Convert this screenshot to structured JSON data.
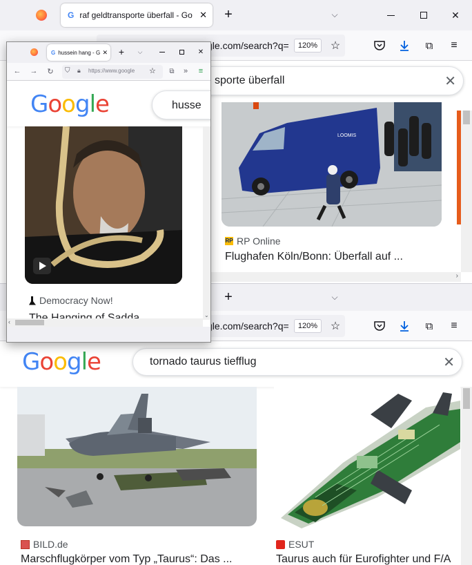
{
  "win_a": {
    "tab_title": "raf geldtransporte überfall - Go",
    "url_visible": "gle.com/search?q=",
    "zoom": "120%",
    "search_query_visible": "sporte überfall",
    "result": {
      "source": "RP Online",
      "title": "Flughafen Köln/Bonn: Überfall auf ..."
    },
    "van_text": "LOOMIS"
  },
  "win_b": {
    "url_visible": "gle.com/search?q=",
    "zoom": "120%",
    "search_query": "tornado taurus tiefflug",
    "results": [
      {
        "source": "BILD.de",
        "title": "Marschflugkörper vom Typ „Taurus“: Das ..."
      },
      {
        "source": "ESUT",
        "title": "Taurus auch für Eurofighter und F/A"
      }
    ]
  },
  "win_c": {
    "tab_title": "hussein hang - G",
    "url_visible": "https://www.google",
    "search_query_visible": "husse",
    "result": {
      "source": "Democracy Now!",
      "title": "The Hanging of Sadda"
    }
  },
  "google_logo": "Google",
  "colors": {
    "g_blue": "#4285f4",
    "g_red": "#ea4335",
    "g_yellow": "#fbbc05",
    "g_green": "#34a853",
    "firefox": "#ff7139",
    "accent": "#0060df"
  },
  "icons": [
    "firefox-icon",
    "google-favicon",
    "close-icon",
    "plus-icon",
    "chevron-down-icon",
    "minimize-icon",
    "maximize-icon",
    "pocket-icon",
    "download-icon",
    "extensions-icon",
    "menu-icon",
    "star-icon",
    "play-icon"
  ]
}
